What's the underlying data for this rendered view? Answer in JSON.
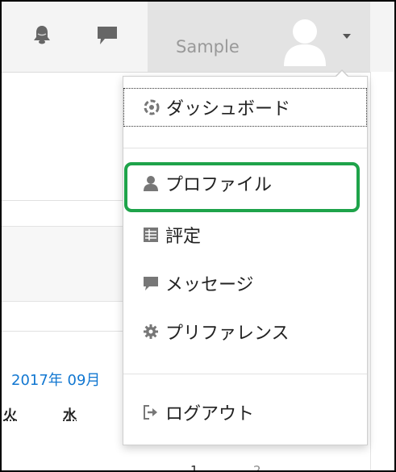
{
  "navbar": {
    "username": "Sample",
    "icons": {
      "notifications": "bell-icon",
      "messages": "message-icon",
      "user": "avatar-icon",
      "menu_toggle": "caret-down-icon"
    }
  },
  "dropdown": {
    "items": [
      {
        "label": "ダッシュボード",
        "icon": "dashboard-icon"
      },
      {
        "label": "プロファイル",
        "icon": "user-icon"
      },
      {
        "label": "評定",
        "icon": "grades-icon"
      },
      {
        "label": "メッセージ",
        "icon": "message-icon"
      },
      {
        "label": "プリファレンス",
        "icon": "wrench-icon"
      },
      {
        "label": "ログアウト",
        "icon": "sign-out-icon"
      }
    ]
  },
  "calendar": {
    "title": "2017年 09月",
    "days": [
      "火",
      "水"
    ],
    "dates": [
      "1",
      "2"
    ]
  },
  "highlight_color": "#1ea34a"
}
